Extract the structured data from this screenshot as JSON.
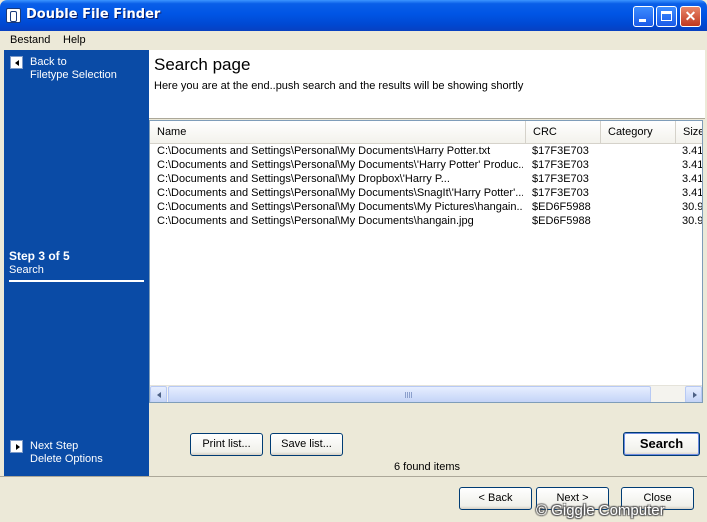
{
  "window": {
    "title": "Double File Finder"
  },
  "menu": {
    "items": [
      {
        "label": "Bestand"
      },
      {
        "label": "Help"
      }
    ]
  },
  "sidebar": {
    "back": {
      "line1": "Back to",
      "line2": "Filetype Selection"
    },
    "step": {
      "title": "Step 3 of 5",
      "name": "Search"
    },
    "next": {
      "line1": "Next Step",
      "line2": "Delete Options"
    }
  },
  "header": {
    "title": "Search page",
    "subtitle": "Here you are at the end..push search and the results will be showing shortly"
  },
  "results": {
    "columns": [
      "Name",
      "CRC",
      "Category",
      "Size"
    ],
    "rows": [
      {
        "name": "C:\\Documents and Settings\\Personal\\My Documents\\Harry Potter.txt",
        "crc": "$17F3E703",
        "category": "",
        "size": "3.41"
      },
      {
        "name": "C:\\Documents and Settings\\Personal\\My Documents\\'Harry Potter' Produc...",
        "crc": "$17F3E703",
        "category": "",
        "size": "3.41"
      },
      {
        "name": "C:\\Documents and Settings\\Personal\\My Dropbox\\'Harry P...",
        "crc": "$17F3E703",
        "category": "",
        "size": "3.41"
      },
      {
        "name": "C:\\Documents and Settings\\Personal\\My Documents\\SnagIt\\'Harry Potter'...",
        "crc": "$17F3E703",
        "category": "",
        "size": "3.41"
      },
      {
        "name": "C:\\Documents and Settings\\Personal\\My Documents\\My Pictures\\hangain...",
        "crc": "$ED6F5988",
        "category": "",
        "size": "30.9"
      },
      {
        "name": "C:\\Documents and Settings\\Personal\\My Documents\\hangain.jpg",
        "crc": "$ED6F5988",
        "category": "",
        "size": "30.9"
      }
    ],
    "found_count": "6 found items"
  },
  "actions": {
    "print": "Print list...",
    "save": "Save list...",
    "search": "Search"
  },
  "wizard": {
    "back": "< Back",
    "next": "Next >",
    "close": "Close"
  },
  "watermark": "© Giggle Computer",
  "colors": {
    "titlebar": "#0055E5",
    "sidebar": "#0A4BA6",
    "window": "#ECE9D8"
  }
}
